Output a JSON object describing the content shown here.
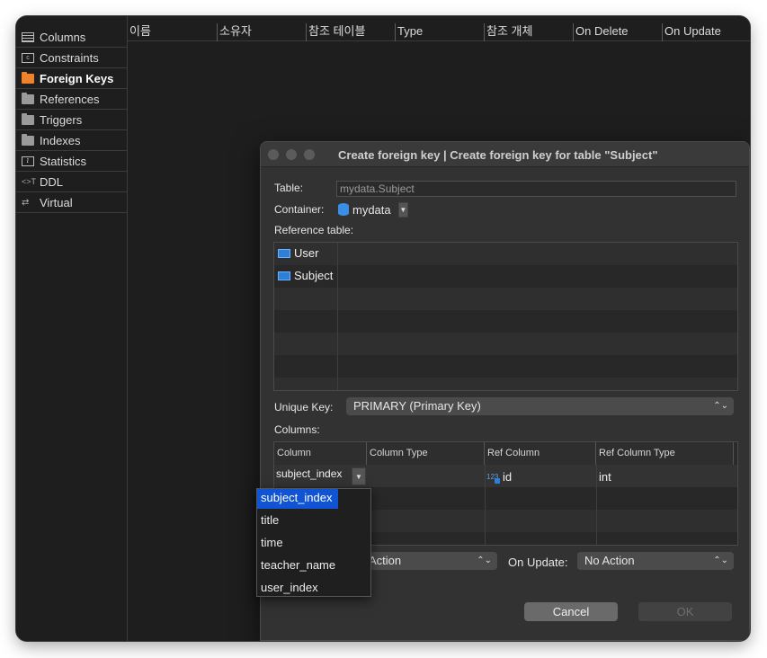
{
  "sidebar": {
    "tabs": [
      {
        "label": "Columns",
        "icon": "columns-icon"
      },
      {
        "label": "Constraints",
        "icon": "constraints-icon"
      },
      {
        "label": "Foreign Keys",
        "icon": "folder-icon",
        "active": true
      },
      {
        "label": "References",
        "icon": "folder-icon"
      },
      {
        "label": "Triggers",
        "icon": "folder-icon"
      },
      {
        "label": "Indexes",
        "icon": "folder-icon"
      },
      {
        "label": "Statistics",
        "icon": "info-icon"
      },
      {
        "label": "DDL",
        "icon": "ddl-icon"
      },
      {
        "label": "Virtual",
        "icon": "virtual-icon"
      }
    ]
  },
  "grid": {
    "headers": [
      "이름",
      "소유자",
      "참조 테이블",
      "Type",
      "참조 개체",
      "On Delete",
      "On Update"
    ]
  },
  "dialog": {
    "title": "Create foreign key | Create foreign key for table \"Subject\"",
    "table_label": "Table:",
    "table_value": "mydata.Subject",
    "container_label": "Container:",
    "container_value": "mydata",
    "reference_table_label": "Reference table:",
    "reference_tables": [
      "User",
      "Subject"
    ],
    "unique_key_label": "Unique Key:",
    "unique_key_value": "PRIMARY (Primary Key)",
    "columns_label": "Columns:",
    "columns_headers": [
      "Column",
      "Column Type",
      "Ref Column",
      "Ref Column Type"
    ],
    "columns_row": {
      "column": "subject_index",
      "column_type": "",
      "ref_column": "id",
      "ref_column_type": "int"
    },
    "on_delete_value": "Action",
    "on_update_label": "On Update:",
    "on_update_value": "No Action",
    "cancel_label": "Cancel",
    "ok_label": "OK"
  },
  "column_dropdown": {
    "options": [
      "subject_index",
      "title",
      "time",
      "teacher_name",
      "user_index"
    ],
    "selected": "subject_index"
  },
  "colors": {
    "accent_orange": "#f0822a",
    "selection_blue": "#1054d4",
    "table_icon_blue": "#2d7fd8"
  }
}
